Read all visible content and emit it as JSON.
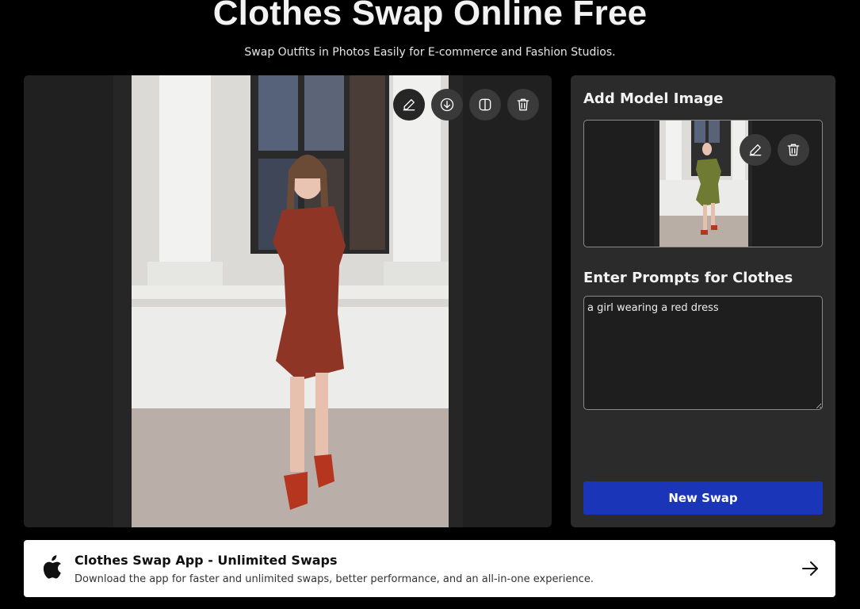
{
  "header": {
    "title": "Clothes Swap Online Free",
    "subtitle": "Swap Outfits in Photos Easily for E-commerce and Fashion Studios."
  },
  "preview": {
    "toolbar": [
      {
        "name": "edit-button",
        "icon": "pencil-icon"
      },
      {
        "name": "download-button",
        "icon": "download-icon"
      },
      {
        "name": "compare-button",
        "icon": "compare-icon"
      },
      {
        "name": "delete-button",
        "icon": "trash-icon"
      }
    ],
    "image": "woman in red short-sleeve dress and red heels standing before white columns"
  },
  "model_section": {
    "title": "Add Model Image",
    "image": "woman in olive green dress and red heels",
    "buttons": [
      {
        "name": "edit-model-button",
        "icon": "pencil-icon"
      },
      {
        "name": "delete-model-button",
        "icon": "trash-icon"
      }
    ]
  },
  "prompt_section": {
    "title": "Enter Prompts for Clothes",
    "value": "a girl wearing a red dress"
  },
  "swap_button": {
    "label": "New Swap",
    "color": "#1a35b8"
  },
  "app_banner": {
    "icon": "apple-icon",
    "title": "Clothes Swap App - Unlimited Swaps",
    "description": "Download the app for faster and unlimited swaps, better performance, and an all-in-one experience.",
    "arrow": "arrow-right-icon"
  }
}
